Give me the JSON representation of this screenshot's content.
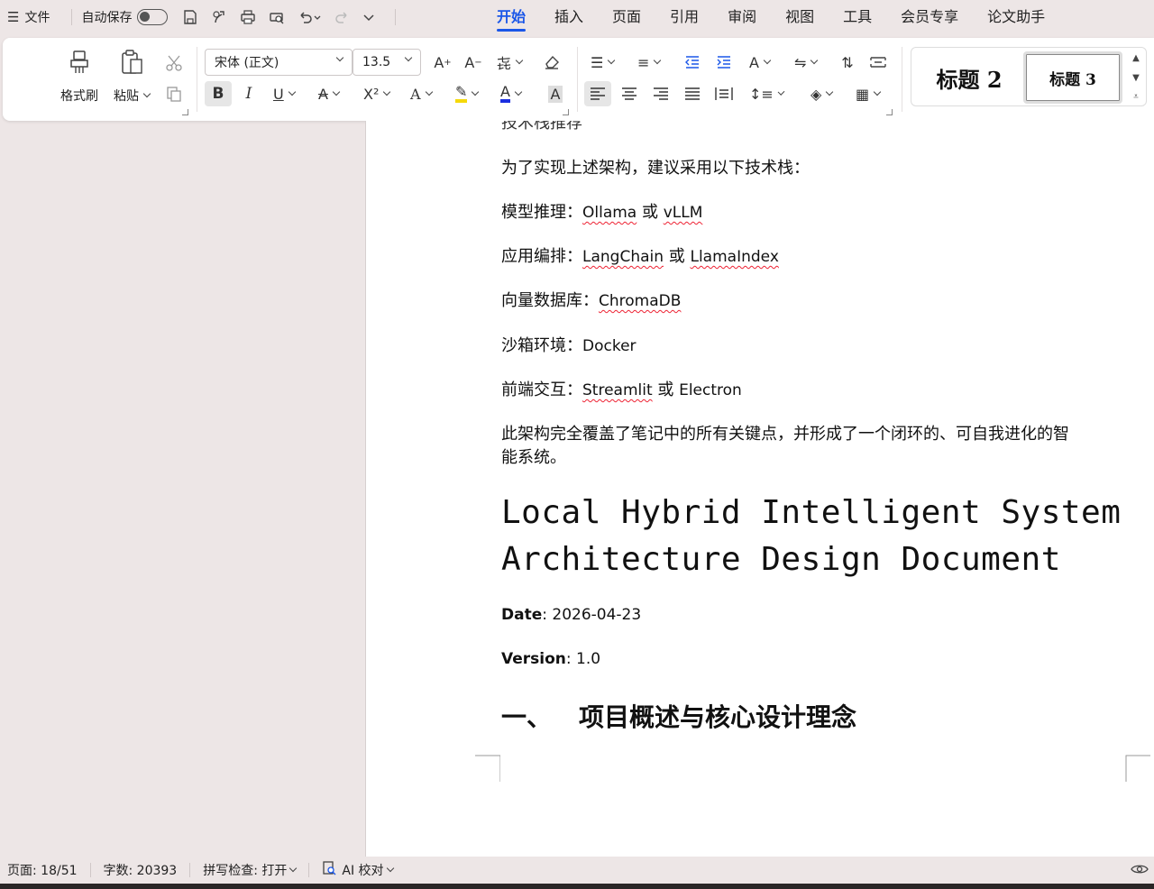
{
  "menubar": {
    "file_label": "文件",
    "autosave_label": "自动保存",
    "tabs": [
      "开始",
      "插入",
      "页面",
      "引用",
      "审阅",
      "视图",
      "工具",
      "会员专享",
      "论文助手"
    ],
    "active_tab": "开始"
  },
  "ribbon": {
    "format_painter": "格式刷",
    "paste": "粘贴",
    "font_name": "宋体 (正文)",
    "font_size": "13.5",
    "style_heading2": "标题 2",
    "style_heading3": "标题 3"
  },
  "document": {
    "partial_heading": "技术栈推荐",
    "intro": "为了实现上述架构，建议采用以下技术栈：",
    "items": [
      {
        "label": "模型推理：",
        "a": "Ollama",
        "or": "或",
        "b": "vLLM"
      },
      {
        "label": "应用编排：",
        "a": "LangChain",
        "or": "或",
        "b": "LlamaIndex"
      },
      {
        "label": "向量数据库：",
        "a": "ChromaDB"
      },
      {
        "label": "沙箱环境：",
        "a": "Docker"
      },
      {
        "label": "前端交互：",
        "a": "Streamlit",
        "or": "或",
        "b": "Electron"
      }
    ],
    "summary_line1": "此架构完全覆盖了笔记中的所有关键点，并形成了一个闭环的、可自我进化的智",
    "summary_line2": "能系统。",
    "title_line1": "Local Hybrid Intelligent System",
    "title_line2": "Architecture Design Document",
    "date_label": "Date",
    "date_value": ": 2026-04-23",
    "version_label": "Version",
    "version_value": ": 1.0",
    "section_num": "一、",
    "section_title": "项目概述与核心设计理念"
  },
  "statusbar": {
    "page": "页面: 18/51",
    "word_count": "字数: 20393",
    "spell_check": "拼写检查: 打开",
    "ai_proof": "AI 校对"
  },
  "colors": {
    "accent": "#1a56e8",
    "squiggle": "#e22233",
    "background": "#ede6e6"
  }
}
